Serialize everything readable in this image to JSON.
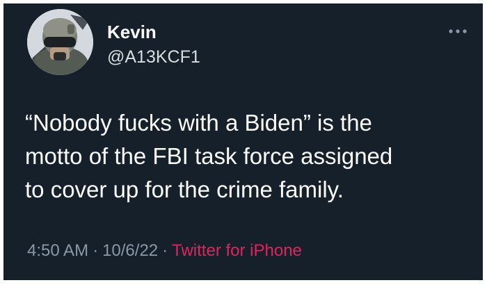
{
  "tweet": {
    "author": {
      "name": "Kevin",
      "handle": "@A13KCF1"
    },
    "text": "“Nobody fucks with a Biden” is the\nmotto of the FBI task force assigned\nto cover up for the crime family.",
    "time": "4:50 AM",
    "date": "10/6/22",
    "separator": "·",
    "source": "Twitter for iPhone"
  },
  "icons": {
    "more": "more-dots-icon"
  },
  "colors": {
    "background": "#15202b",
    "text": "#ffffff",
    "muted": "#8b98a5",
    "source_link": "#e0245e"
  }
}
